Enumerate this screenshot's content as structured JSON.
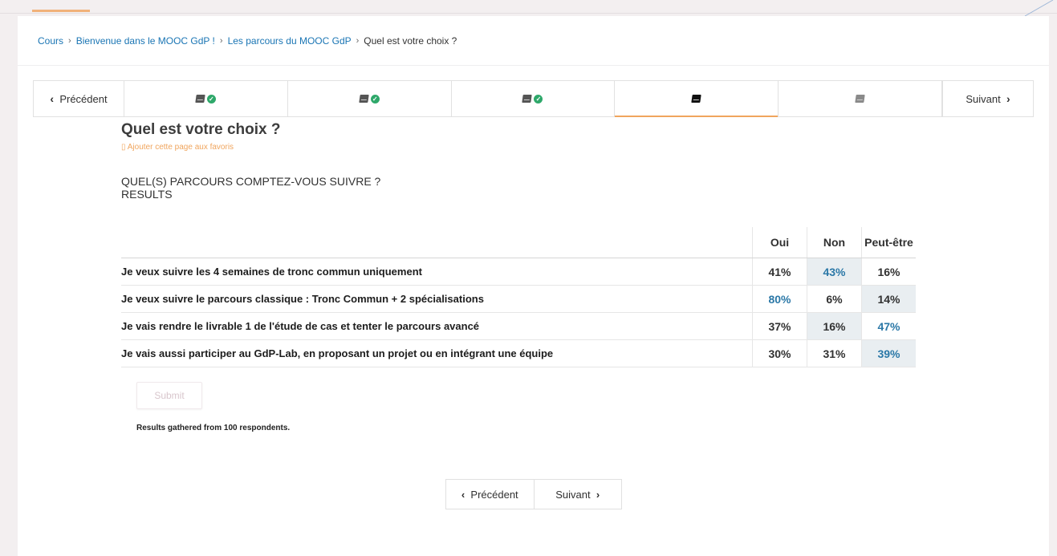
{
  "breadcrumb": {
    "items": [
      "Cours",
      "Bienvenue dans le MOOC GdP !",
      "Les parcours du MOOC GdP"
    ],
    "current": "Quel est votre choix ?",
    "separator": "›"
  },
  "sequence_nav": {
    "previous_label": "Précédent",
    "next_label": "Suivant",
    "units": [
      {
        "icon": "book-icon",
        "completed": true
      },
      {
        "icon": "book-icon",
        "completed": true
      },
      {
        "icon": "book-icon",
        "completed": true
      },
      {
        "icon": "book-icon",
        "completed": false,
        "active": true
      },
      {
        "icon": "book-icon",
        "completed": false
      }
    ]
  },
  "page": {
    "title": "Quel est votre choix ?",
    "favorite_label": "Ajouter cette page aux favoris",
    "question_heading": "QUEL(S) PARCOURS COMPTEZ-VOUS SUIVRE ?",
    "results_label": "RESULTS"
  },
  "results_table": {
    "columns": [
      "Oui",
      "Non",
      "Peut-être"
    ],
    "rows": [
      {
        "question": "Je veux suivre les 4 semaines de tronc commun uniquement",
        "values": [
          "41%",
          "43%",
          "16%"
        ],
        "max_index": 1
      },
      {
        "question": "Je veux suivre le parcours classique : Tronc Commun + 2 spécialisations",
        "values": [
          "80%",
          "6%",
          "14%"
        ],
        "max_index": 0
      },
      {
        "question": "Je vais rendre le livrable 1 de l'étude de cas et tenter le parcours avancé",
        "values": [
          "37%",
          "16%",
          "47%"
        ],
        "max_index": 2
      },
      {
        "question": "Je vais aussi participer au GdP-Lab, en proposant un projet ou en intégrant une équipe",
        "values": [
          "30%",
          "31%",
          "39%"
        ],
        "max_index": 2
      }
    ]
  },
  "submit_label": "Submit",
  "respondents_text": "Results gathered from 100 respondents.",
  "bottom_nav": {
    "previous_label": "Précédent",
    "next_label": "Suivant"
  },
  "colors": {
    "accent": "#f0a55d",
    "link": "#1a75b4",
    "highlight_value": "#2b78a7",
    "shade": "#e9eef1",
    "check": "#2ea86a"
  }
}
